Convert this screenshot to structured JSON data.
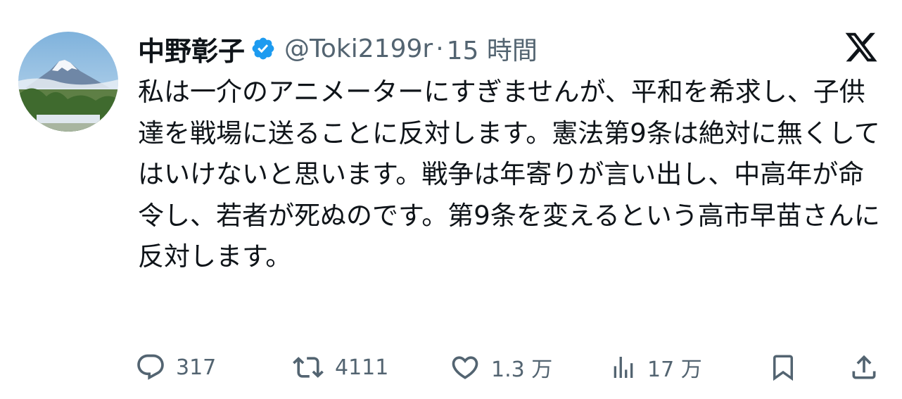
{
  "tweet": {
    "author": {
      "display_name": "中野彰子",
      "handle": "@Toki2199r",
      "verified": true,
      "avatar_subject": "mount-fuji-landscape"
    },
    "separator": "·",
    "timestamp": "15 時間",
    "text": "私は一介のアニメーターにすぎませんが、平和を希求し、子供達を戦場に送ることに反対します。憲法第9条は絶対に無くしてはいけないと思います。戦争は年寄りが言い出し、中高年が命令し、若者が死ぬのです。第9条を変えるという高市早苗さんに反対します。",
    "platform_logo": "x-logo"
  },
  "actions": {
    "reply": {
      "icon": "reply-icon",
      "count": "317"
    },
    "retweet": {
      "icon": "retweet-icon",
      "count": "4111"
    },
    "like": {
      "icon": "heart-icon",
      "count": "1.3 万"
    },
    "views": {
      "icon": "views-icon",
      "count": "17 万"
    },
    "bookmark": {
      "icon": "bookmark-icon"
    },
    "share": {
      "icon": "share-icon"
    }
  },
  "colors": {
    "text_primary": "#0f1419",
    "text_secondary": "#536471",
    "verified_blue": "#1d9bf0",
    "background": "#ffffff"
  }
}
